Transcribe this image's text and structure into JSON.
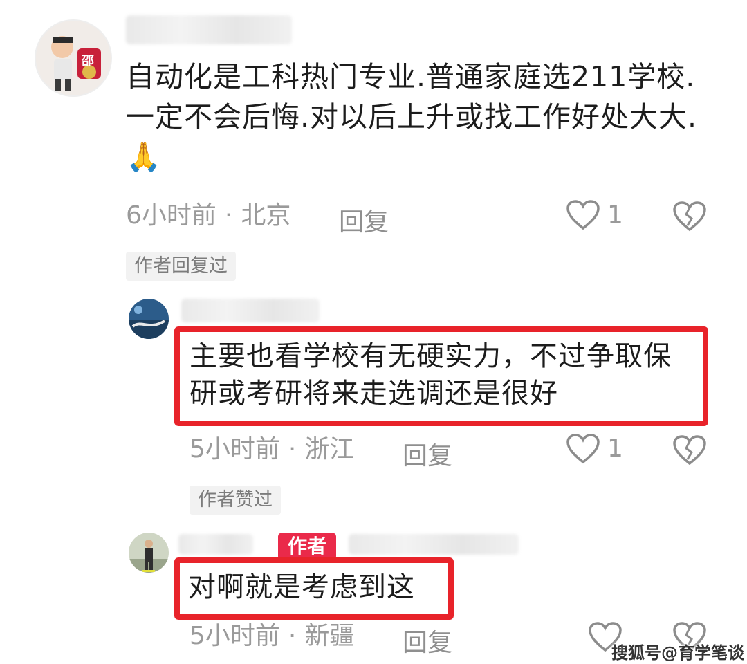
{
  "comments": [
    {
      "text": "自动化是工科热门专业.普通家庭选211学校.一定不会后悔.对以后上升或找工作好处大大.",
      "emoji": "🙏",
      "time": "6小时前",
      "location": "北京",
      "reply_label": "回复",
      "like_count": "1",
      "tag": "作者回复过"
    },
    {
      "text": "主要也看学校有无硬实力，不过争取保研或考研将来走选调还是很好",
      "time": "5小时前",
      "location": "浙江",
      "reply_label": "回复",
      "like_count": "1",
      "tag": "作者赞过"
    },
    {
      "author_badge": "作者",
      "text": "对啊就是考虑到这",
      "time": "5小时前",
      "location": "新疆",
      "reply_label": "回复"
    }
  ],
  "avatar_badge": "邵",
  "separator": "·",
  "watermark": "搜狐号@育学笔谈",
  "colors": {
    "highlight": "#e8232a",
    "author_badge": "#ea2a4a"
  }
}
